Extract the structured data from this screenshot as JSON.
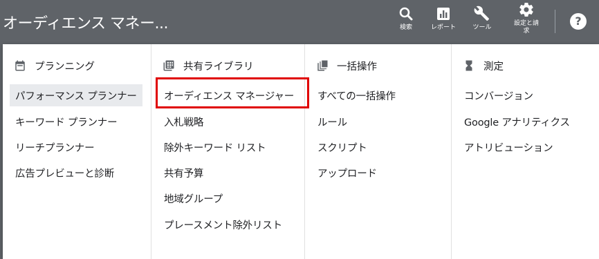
{
  "header": {
    "app_title": "オーディエンス マネー...",
    "tools": [
      {
        "label": "検索",
        "icon": "search-icon"
      },
      {
        "label": "レポート",
        "icon": "report-icon"
      },
      {
        "label": "ツール",
        "icon": "wrench-icon"
      },
      {
        "label": "設定と請求",
        "icon": "gear-icon"
      }
    ],
    "help_symbol": "?"
  },
  "menu": {
    "columns": [
      {
        "title": "プランニング",
        "icon": "calendar-icon",
        "items": [
          "パフォーマンス プランナー",
          "キーワード プランナー",
          "リーチプランナー",
          "広告プレビューと診断"
        ],
        "active_index": 0
      },
      {
        "title": "共有ライブラリ",
        "icon": "library-grid-icon",
        "items": [
          "オーディエンス マネージャー",
          "入札戦略",
          "除外キーワード リスト",
          "共有予算",
          "地域グループ",
          "プレースメント除外リスト"
        ],
        "highlighted_index": 0
      },
      {
        "title": "一括操作",
        "icon": "copy-stack-icon",
        "items": [
          "すべての一括操作",
          "ルール",
          "スクリプト",
          "アップロード"
        ]
      },
      {
        "title": "測定",
        "icon": "hourglass-icon",
        "items": [
          "コンバージョン",
          "Google アナリティクス",
          "アトリビューション"
        ]
      }
    ]
  },
  "colors": {
    "topbar": "#5f6368",
    "active_item_bg": "#e8eaed",
    "highlight_border": "#e00000"
  }
}
